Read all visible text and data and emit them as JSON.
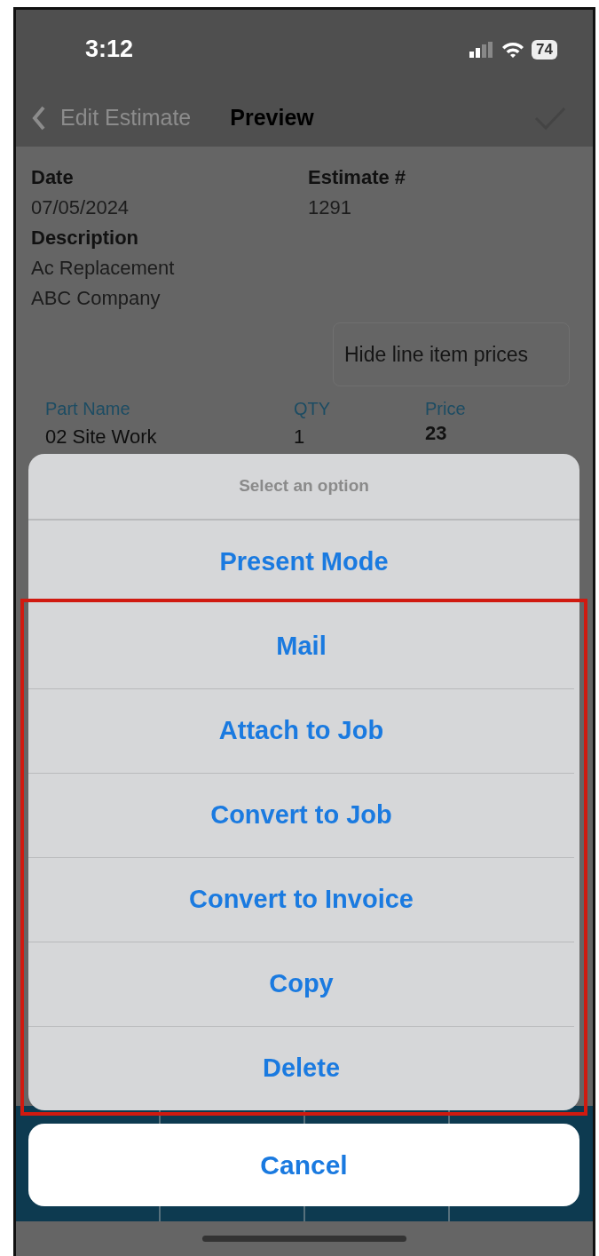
{
  "status_bar": {
    "time": "3:12",
    "battery": "74"
  },
  "nav": {
    "back": "Edit Estimate",
    "title": "Preview"
  },
  "fields": [
    {
      "label": "Date",
      "value": "07/05/2024"
    },
    {
      "label": "Estimate #",
      "value": "1291"
    }
  ],
  "description": {
    "label": "Description",
    "lines": [
      "Ac Replacement",
      "ABC Company"
    ]
  },
  "hide_prices_button": "Hide line item prices",
  "table": {
    "columns": [
      "Part Name",
      "QTY",
      "Price"
    ],
    "rows": [
      [
        "02 Site Work",
        "1",
        "23"
      ]
    ]
  },
  "action_sheet": {
    "title": "Select an option",
    "options": [
      {
        "label": "Present Mode",
        "highlighted": false
      },
      {
        "label": "Mail",
        "highlighted": true
      },
      {
        "label": "Attach to Job",
        "highlighted": true
      },
      {
        "label": "Convert to Job",
        "highlighted": true
      },
      {
        "label": "Convert to Invoice",
        "highlighted": true
      },
      {
        "label": "Copy",
        "highlighted": true
      },
      {
        "label": "Delete",
        "highlighted": true
      }
    ],
    "cancel": "Cancel"
  }
}
